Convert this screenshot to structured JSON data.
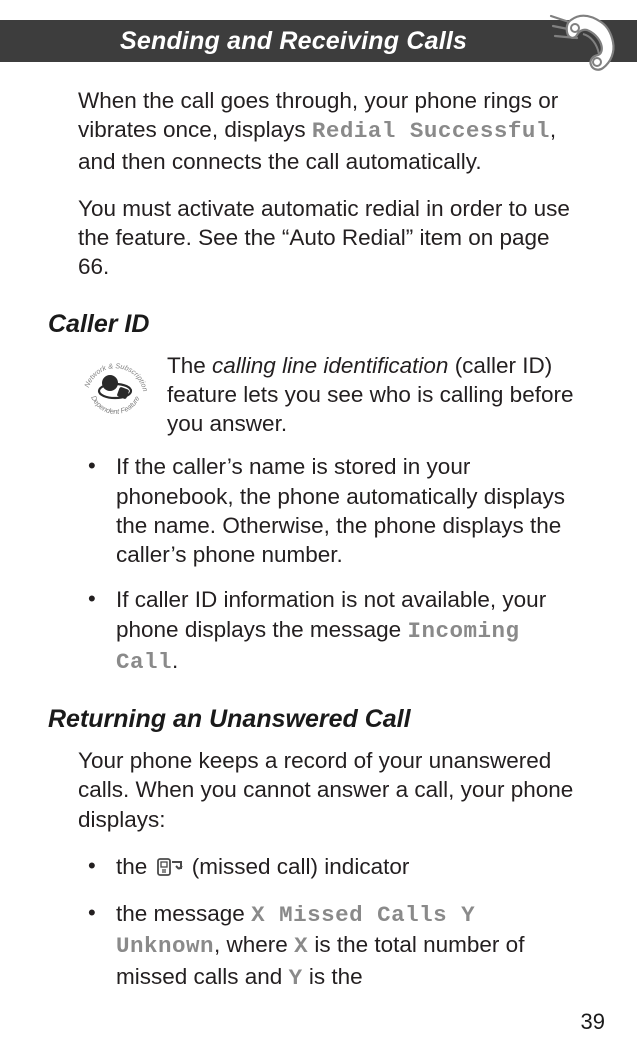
{
  "header": {
    "title": "Sending and Receiving Calls"
  },
  "intro": {
    "p1a": "When the call goes through, your phone rings or vibrates once, displays ",
    "p1code": "Redial Successful",
    "p1b": ", and then connects the call automatically.",
    "p2": "You must activate automatic redial in order to use the feature. See the “Auto Redial” item on page 66."
  },
  "callerId": {
    "heading": "Caller ID",
    "leadA": "The ",
    "leadItalic": "calling line identification",
    "leadB": " (caller ID) feature lets you see who is calling before you answer.",
    "bullets": {
      "b1": "If the caller’s name is stored in your phonebook, the phone automatically displays the name. Otherwise, the phone displays the caller’s phone number.",
      "b2a": "If caller ID information is not available, your phone displays the message ",
      "b2code": "Incoming Call",
      "b2b": "."
    }
  },
  "returning": {
    "heading": "Returning an Unanswered Call",
    "p1": "Your phone keeps a record of your unanswered calls. When you cannot answer a call, your phone displays:",
    "bullets": {
      "b1a": "the ",
      "b1b": " (missed call) indicator",
      "b2a": "the message ",
      "b2code": "X Missed Calls Y Unknown",
      "b2b": ", where ",
      "b2codeX": "X",
      "b2c": " is the total number of missed calls and ",
      "b2codeY": "Y",
      "b2d": " is the"
    }
  },
  "pageNumber": "39"
}
